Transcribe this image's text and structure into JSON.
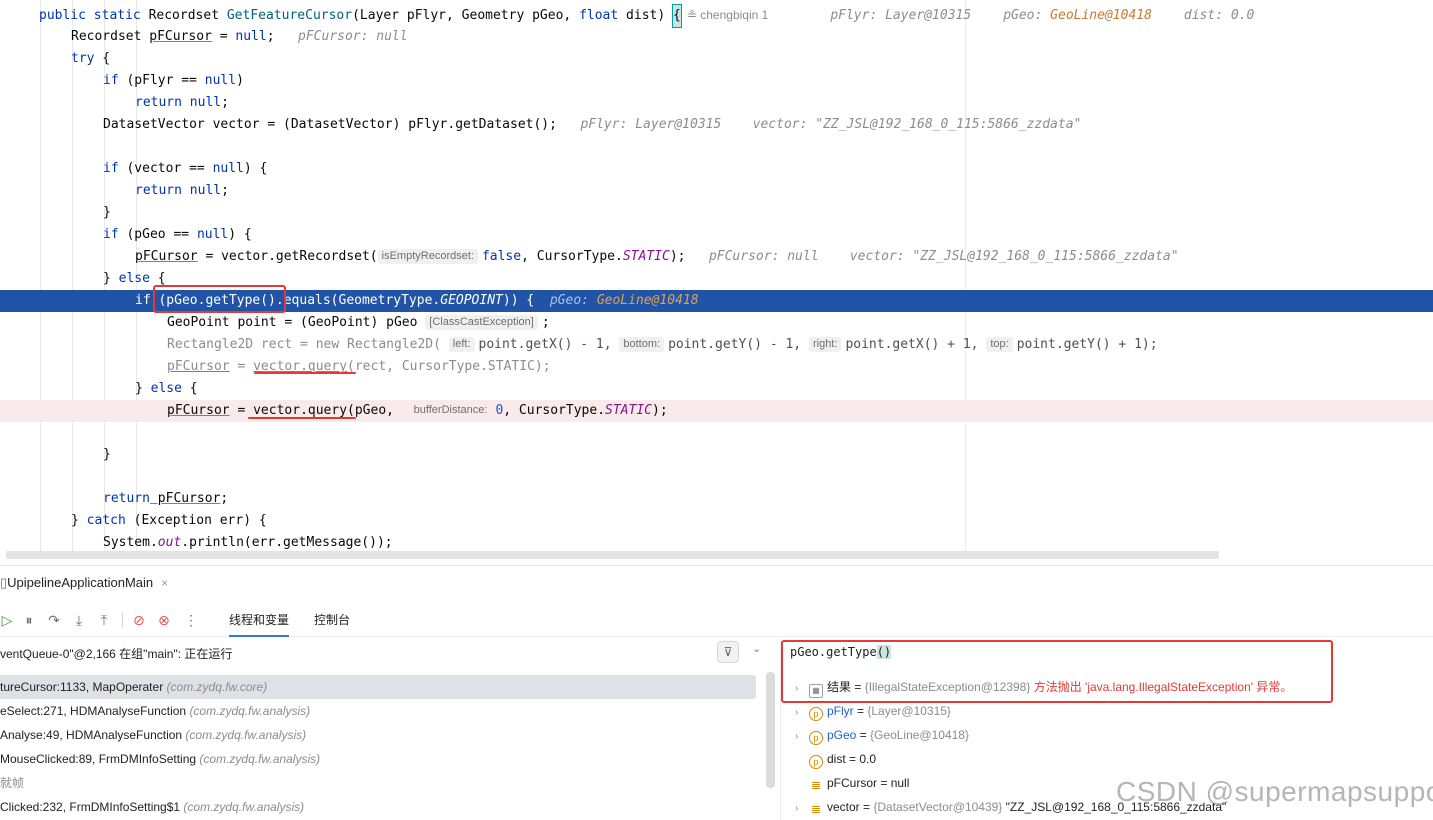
{
  "editor": {
    "signature": {
      "kw": "public static",
      "type": "Recordset",
      "method": "GetFeatureCursor",
      "params_pre": "(Layer pFlyr, Geometry pGeo, ",
      "float_kw": "float",
      "params_post": " dist) ",
      "brace": "{",
      "author": "chengbiqin 1",
      "hint_flyr": "pFlyr: Layer@10315",
      "hint_geo_label": "pGeo:",
      "hint_geo_val": "GeoLine@10418",
      "hint_dist": "dist: 0.0"
    },
    "l2": {
      "type": "Recordset ",
      "var": "pFCursor",
      "eq": " = ",
      "null": "null",
      "end": ";",
      "hint": "pFCursor: null"
    },
    "l3": {
      "kw": "try",
      "rest": " {"
    },
    "l4": {
      "kw": "if",
      "pre": " (pFlyr == ",
      "null": "null",
      "post": ")"
    },
    "l5": {
      "kw": "return",
      "null": " null",
      "end": ";"
    },
    "l6": {
      "code": "DatasetVector vector = (DatasetVector) pFlyr.getDataset();",
      "hint1": "pFlyr: Layer@10315",
      "hint2": "vector: \"ZZ_JSL@192_168_0_115:5866_zzdata\""
    },
    "l8": {
      "kw": "if",
      "pre": " (vector == ",
      "null": "null",
      "post": ") {"
    },
    "l9": {
      "kw": "return",
      "null": " null",
      "end": ";"
    },
    "l10": {
      "code": "}"
    },
    "l11": {
      "kw": "if",
      "pre": " (pGeo == ",
      "null": "null",
      "post": ") {"
    },
    "l12": {
      "var": "pFCursor",
      "pre": " = vector.getRecordset(",
      "inlay": "isEmptyRecordset:",
      "kw": "false",
      "mid": ", CursorType.",
      "fld": "STATIC",
      "end": ");",
      "hint1": "pFCursor: null",
      "hint2": "vector: \"ZZ_JSL@192_168_0_115:5866_zzdata\""
    },
    "l13": {
      "close": "} ",
      "kw": "else",
      "rest": " {"
    },
    "l14": {
      "kw": "if",
      "pre": " (pGeo.getType().equals(GeometryType.",
      "fld": "GEOPOINT",
      "post": ")) {",
      "hint_label": "pGeo:",
      "hint_val": "GeoLine@10418"
    },
    "l15": {
      "code": "GeoPoint point = (GeoPoint) pGeo ",
      "inlay": "[ClassCastException]",
      "end": ";"
    },
    "l16": {
      "pre": "Rectangle2D rect = new Rectangle2D(",
      "in1": "left:",
      "a1": "point.getX() - 1, ",
      "in2": "bottom:",
      "a2": "point.getY() - 1, ",
      "in3": "right:",
      "a3": "point.getX() + 1, ",
      "in4": "top:",
      "a4": "point.getY() + 1);"
    },
    "l17": {
      "var": "pFCursor",
      "pre": " = ",
      "call": "vector.query",
      "post": "(rect, CursorType.STATIC);"
    },
    "l18": {
      "close": "} ",
      "kw": "else",
      "rest": " {"
    },
    "l19": {
      "var": "pFCursor",
      "pre": " = ",
      "call": "vector.query",
      "post": "(pGeo, ",
      "inlay": "bufferDistance:",
      "num": "0",
      "mid": ", CursorType.",
      "fld": "STATIC",
      "end": ");"
    },
    "l21": {
      "code": "}"
    },
    "l23": {
      "kw": "return",
      "var": " pFCursor",
      "end": ";"
    },
    "l24": {
      "close": "} ",
      "kw": "catch",
      "rest": " (Exception err) {"
    },
    "l25": {
      "pre": "System.",
      "fld": "out",
      "post": ".println(err.getMessage());"
    }
  },
  "debugger": {
    "session_tab": "UpipelineApplicationMain",
    "close_glyph": "×",
    "tabs": [
      "线程和变量",
      "控制台"
    ],
    "thread": "ventQueue-0\"@2,166 在组\"main\": 正在运行",
    "frames": [
      {
        "method": "tureCursor:1133, MapOperater ",
        "pkg": "(com.zydq.fw.core)"
      },
      {
        "method": "eSelect:271, HDMAnalyseFunction ",
        "pkg": "(com.zydq.fw.analysis)"
      },
      {
        "method": "Analyse:49, HDMAnalyseFunction ",
        "pkg": "(com.zydq.fw.analysis)"
      },
      {
        "method": "MouseClicked:89, FrmDMInfoSetting ",
        "pkg": "(com.zydq.fw.analysis)"
      },
      {
        "method": "就帧",
        "pkg": ""
      },
      {
        "method": "Clicked:232, FrmDMInfoSetting$1 ",
        "pkg": "(com.zydq.fw.analysis)"
      }
    ],
    "expression": "pGeo.getType",
    "expression_paren": "()",
    "variables": [
      {
        "name": "结果",
        "eq": " = ",
        "obj": "{IllegalStateException@12398} ",
        "red": "方法抛出 'java.lang.IllegalStateException' 异常。",
        "icon": "result-icon"
      },
      {
        "name": "pFlyr",
        "eq": " = ",
        "obj": "{Layer@10315}",
        "icon": "param-icon"
      },
      {
        "name": "pGeo",
        "eq": " = ",
        "obj": "{GeoLine@10418}",
        "icon": "param-icon"
      },
      {
        "name": "dist",
        "eq": " = ",
        "val": "0.0",
        "icon": "param-icon"
      },
      {
        "name": "pFCursor",
        "eq": " = ",
        "val": "null",
        "icon": "field-icon"
      },
      {
        "name": "vector",
        "eq": " = ",
        "obj": "{DatasetVector@10439} ",
        "val": "\"ZZ_JSL@192_168_0_115:5866_zzdata\"",
        "icon": "field-icon"
      }
    ]
  },
  "watermark": "CSDN @supermapsupport",
  "colors": {
    "exec_line": "#2154a6",
    "error_line": "#fbeaea",
    "annotation_red": "#e53935",
    "keyword": "#0033b3"
  }
}
